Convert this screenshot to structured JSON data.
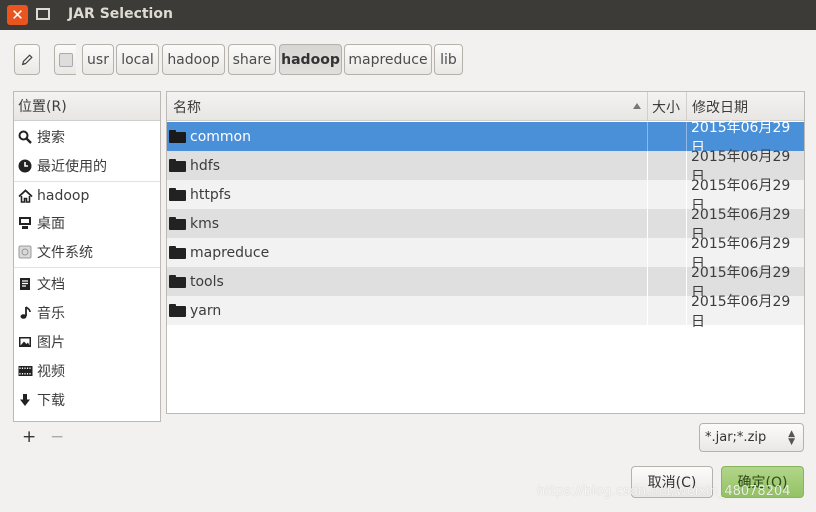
{
  "window": {
    "title": "JAR Selection"
  },
  "pathbar": {
    "crumbs": [
      "usr",
      "local",
      "hadoop",
      "share",
      "hadoop",
      "mapreduce",
      "lib"
    ],
    "active_index": 4
  },
  "sidebar": {
    "header": "位置(R)",
    "items": [
      {
        "label": "搜索",
        "icon": "search-icon"
      },
      {
        "label": "最近使用的",
        "icon": "clock-icon"
      },
      {
        "label": "hadoop",
        "icon": "home-icon"
      },
      {
        "label": "桌面",
        "icon": "desktop-icon"
      },
      {
        "label": "文件系统",
        "icon": "drive-icon"
      },
      {
        "label": "文档",
        "icon": "document-icon"
      },
      {
        "label": "音乐",
        "icon": "music-icon"
      },
      {
        "label": "图片",
        "icon": "picture-icon"
      },
      {
        "label": "视频",
        "icon": "video-icon"
      },
      {
        "label": "下载",
        "icon": "download-icon"
      }
    ],
    "add_label": "+",
    "remove_label": "−"
  },
  "filelist": {
    "columns": {
      "name": "名称",
      "size": "大小",
      "modified": "修改日期"
    },
    "rows": [
      {
        "name": "common",
        "size": "",
        "modified": "2015年06月29日",
        "selected": true
      },
      {
        "name": "hdfs",
        "size": "",
        "modified": "2015年06月29日"
      },
      {
        "name": "httpfs",
        "size": "",
        "modified": "2015年06月29日"
      },
      {
        "name": "kms",
        "size": "",
        "modified": "2015年06月29日"
      },
      {
        "name": "mapreduce",
        "size": "",
        "modified": "2015年06月29日"
      },
      {
        "name": "tools",
        "size": "",
        "modified": "2015年06月29日"
      },
      {
        "name": "yarn",
        "size": "",
        "modified": "2015年06月29日"
      }
    ]
  },
  "filter": {
    "value": "*.jar;*.zip"
  },
  "buttons": {
    "cancel": "取消(C)",
    "ok": "确定(O)"
  },
  "watermark": "https://blog.csdn.net/weixin_48078204",
  "colors": {
    "titlebar": "#3c3b37",
    "close": "#e9541f",
    "selection": "#4a90d9",
    "ok_button": "#9cc86d"
  }
}
